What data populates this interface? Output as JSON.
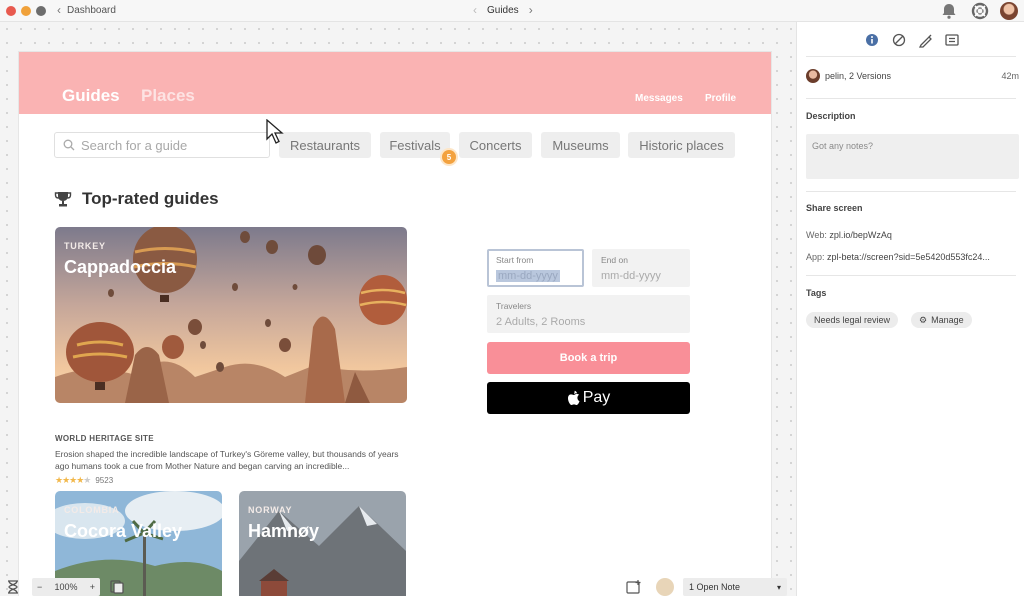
{
  "titlebar": {
    "back_label": "Dashboard",
    "title": "Guides"
  },
  "hero": {
    "tabs": [
      {
        "label": "Guides",
        "active": true
      },
      {
        "label": "Places",
        "active": false
      }
    ],
    "links": [
      "Messages",
      "Profile"
    ],
    "bg_color": "#fab3b3"
  },
  "search": {
    "placeholder": "Search for a guide"
  },
  "categories": [
    "Restaurants",
    "Festivals",
    "Concerts",
    "Museums",
    "Historic places"
  ],
  "badge": {
    "count": "5"
  },
  "section": {
    "title": "Top-rated guides"
  },
  "cards": [
    {
      "country": "TURKEY",
      "name": "Cappadoccia",
      "meta": "WORLD HERITAGE SITE",
      "description": "Erosion shaped the incredible landscape of Turkey's Göreme valley, but thousands of years ago humans took a cue from Mother Nature and began carving an incredible...",
      "rating": 4,
      "reviews": "9523"
    },
    {
      "country": "COLOMBIA",
      "name": "Cocora Valley"
    },
    {
      "country": "NORWAY",
      "name": "Hamnøy"
    }
  ],
  "booking": {
    "start_label": "Start from",
    "start_value": "mm-dd-yyyy",
    "end_label": "End on",
    "end_value": "mm-dd-yyyy",
    "travelers_label": "Travelers",
    "travelers_value": "2 Adults, 2 Rooms",
    "book_label": "Book a trip",
    "pay_label": "Pay",
    "accent": "#f98f98"
  },
  "bottombar": {
    "zoom_minus": "−",
    "zoom_level": "100%",
    "zoom_plus": "+",
    "notes_select": "1 Open Note"
  },
  "panel": {
    "version_user": "pelin, 2 Versions",
    "version_time": "42m",
    "description_heading": "Description",
    "notes_placeholder": "Got any notes?",
    "share_heading": "Share screen",
    "web_label": "Web:",
    "web_value": "zpl.io/bepWzAq",
    "app_label": "App:",
    "app_value": "zpl-beta://screen?sid=5e5420d553fc24...",
    "tags_heading": "Tags",
    "tags": [
      "Needs legal review"
    ],
    "manage_label": "Manage"
  }
}
